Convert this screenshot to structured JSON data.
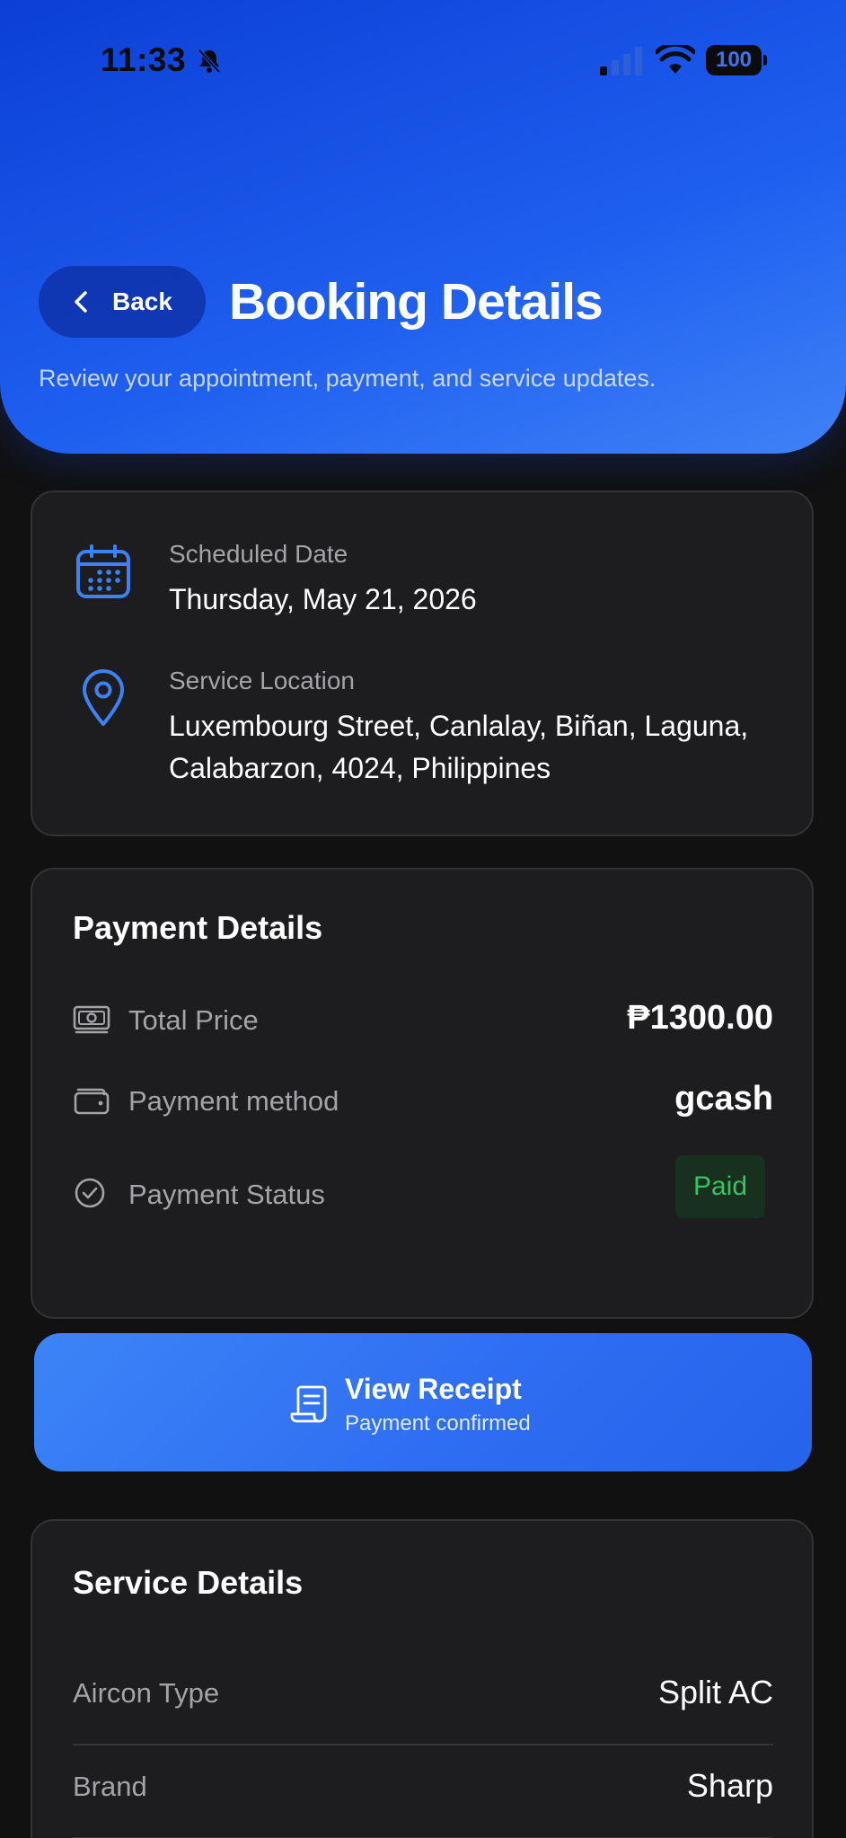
{
  "status_bar": {
    "time": "11:33",
    "battery": "100"
  },
  "header": {
    "back_label": "Back",
    "title": "Booking Details",
    "subtitle": "Review your appointment, payment, and service updates."
  },
  "schedule": {
    "date_label": "Scheduled Date",
    "date_value": "Thursday, May 21, 2026",
    "location_label": "Service Location",
    "location_value": "Luxembourg Street, Canlalay, Biñan, Laguna, Calabarzon, 4024, Philippines"
  },
  "payment": {
    "title": "Payment Details",
    "total_label": "Total Price",
    "total_value": "₱1300.00",
    "method_label": "Payment method",
    "method_value": "gcash",
    "status_label": "Payment Status",
    "status_value": "Paid"
  },
  "receipt": {
    "title": "View Receipt",
    "subtitle": "Payment confirmed"
  },
  "service": {
    "title": "Service Details",
    "rows": [
      {
        "label": "Aircon Type",
        "value": "Split AC"
      },
      {
        "label": "Brand",
        "value": "Sharp"
      }
    ]
  },
  "colors": {
    "accent": "#3b82f6",
    "header_start": "#0b3fd6",
    "paid_green": "#36c463",
    "card_bg": "#1d1d1f",
    "page_bg": "#111112"
  },
  "icons": {
    "bell": "bell-slash-icon",
    "signal": "cellular-signal-icon",
    "wifi": "wifi-icon",
    "battery": "battery-icon",
    "back": "chevron-left-icon",
    "calendar": "calendar-icon",
    "location": "map-pin-icon",
    "money": "banknote-icon",
    "wallet": "wallet-icon",
    "check": "check-circle-icon",
    "receipt": "receipt-icon"
  }
}
